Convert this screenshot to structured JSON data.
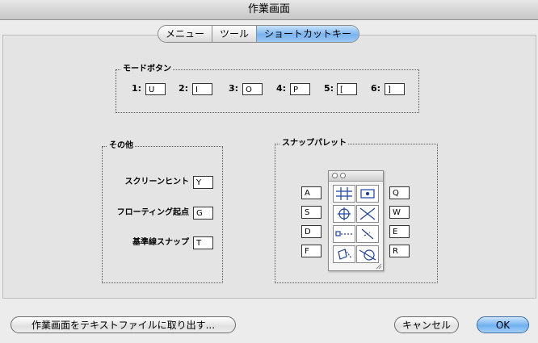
{
  "window": {
    "title": "作業画面"
  },
  "tabs": [
    {
      "label": "メニュー"
    },
    {
      "label": "ツール"
    },
    {
      "label": "ショートカットキー",
      "selected": true
    }
  ],
  "mode_buttons": {
    "title": "モードボタン",
    "items": [
      {
        "label": "1:",
        "value": "U"
      },
      {
        "label": "2:",
        "value": "I"
      },
      {
        "label": "3:",
        "value": "O"
      },
      {
        "label": "4:",
        "value": "P"
      },
      {
        "label": "5:",
        "value": "["
      },
      {
        "label": "6:",
        "value": "]"
      }
    ]
  },
  "other": {
    "title": "その他",
    "items": [
      {
        "label": "スクリーンヒント",
        "value": "Y"
      },
      {
        "label": "フローティング起点",
        "value": "G"
      },
      {
        "label": "基準線スナップ",
        "value": "T"
      }
    ]
  },
  "snap_palette": {
    "title": "スナップパレット",
    "left_keys": [
      "A",
      "S",
      "D",
      "F"
    ],
    "right_keys": [
      "Q",
      "W",
      "E",
      "R"
    ],
    "icons": [
      "grid-snap-icon",
      "rectangle-snap-icon",
      "circle-center-snap-icon",
      "intersection-snap-icon",
      "endpoint-snap-icon",
      "midpoint-snap-icon",
      "perpendicular-snap-icon",
      "tangent-snap-icon"
    ]
  },
  "buttons": {
    "export": "作業画面をテキストファイルに取り出す...",
    "cancel": "キャンセル",
    "ok": "OK"
  },
  "colors": {
    "accent": "#79b4ef",
    "icon_blue": "#1b3fa3"
  }
}
